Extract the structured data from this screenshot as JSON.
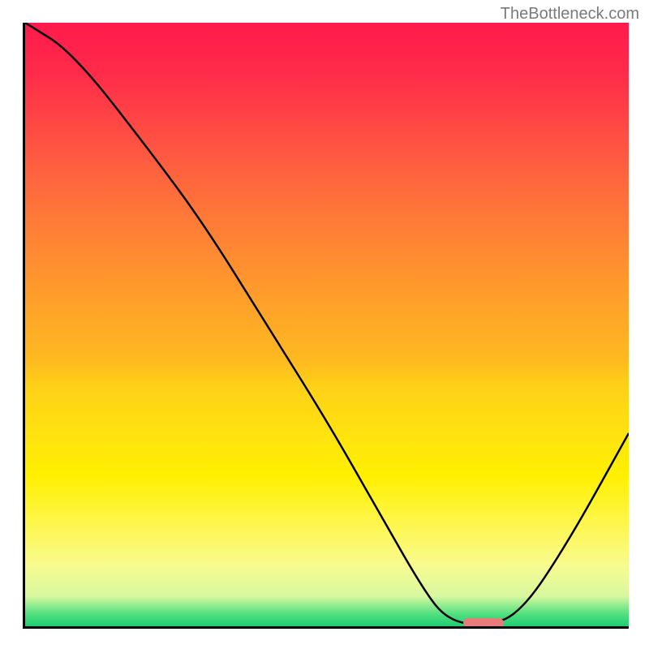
{
  "watermark": "TheBottleneck.com",
  "chart_data": {
    "type": "line",
    "title": "",
    "xlabel": "",
    "ylabel": "",
    "xlim": [
      0,
      100
    ],
    "ylim": [
      0,
      100
    ],
    "x": [
      0,
      8,
      22,
      30,
      40,
      50,
      58,
      66,
      70,
      76,
      82,
      90,
      100
    ],
    "values": [
      100,
      95,
      77,
      66,
      50,
      34,
      20,
      6,
      1,
      0,
      2,
      14,
      32
    ],
    "optimal_x": 76,
    "gradient_stops": [
      {
        "pos": 0,
        "color": "#ff1a4d"
      },
      {
        "pos": 50,
        "color": "#ffba20"
      },
      {
        "pos": 85,
        "color": "#fdf860"
      },
      {
        "pos": 100,
        "color": "#20cc70"
      }
    ]
  }
}
